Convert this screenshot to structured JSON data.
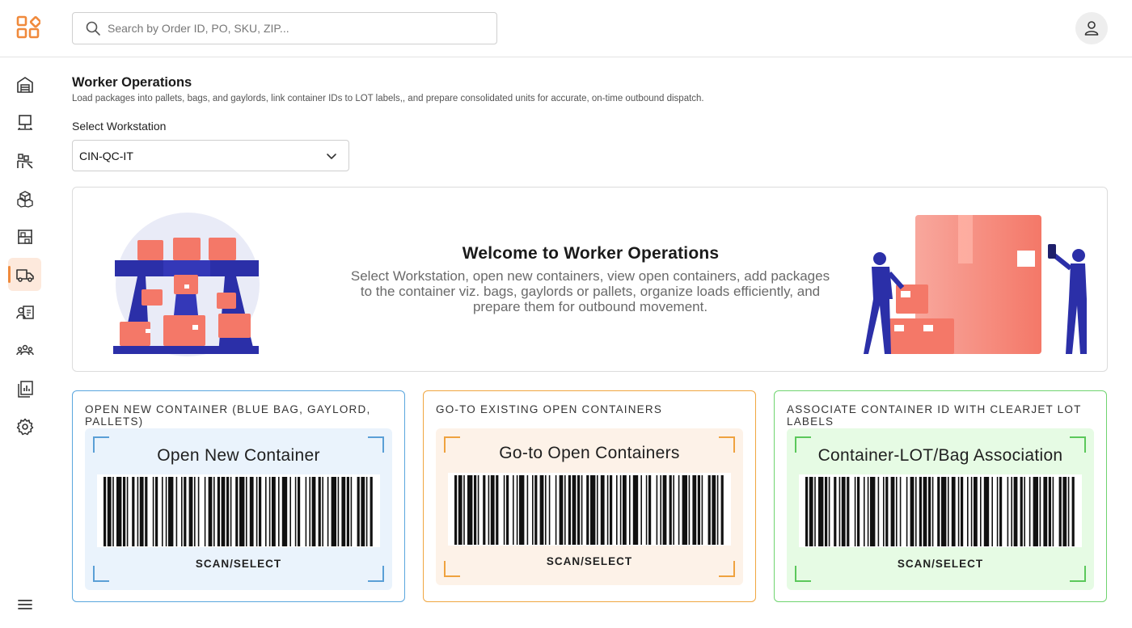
{
  "header": {
    "logo": "app-logo",
    "search": {
      "placeholder": "Search by Order ID, PO, SKU, ZIP...",
      "value": ""
    },
    "user_icon": "user-icon"
  },
  "sidebar": {
    "items": [
      {
        "id": "home",
        "icon": "warehouse-icon",
        "active": false
      },
      {
        "id": "workstation",
        "icon": "workstation-icon",
        "active": false
      },
      {
        "id": "conveyor",
        "icon": "conveyor-icon",
        "active": false
      },
      {
        "id": "inventory",
        "icon": "boxes-icon",
        "active": false
      },
      {
        "id": "storage",
        "icon": "rack-icon",
        "active": false
      },
      {
        "id": "dispatch",
        "icon": "truck-icon",
        "active": true
      },
      {
        "id": "workers",
        "icon": "worker-card-icon",
        "active": false
      },
      {
        "id": "teams",
        "icon": "team-icon",
        "active": false
      },
      {
        "id": "reports",
        "icon": "reports-icon",
        "active": false
      },
      {
        "id": "settings",
        "icon": "gear-icon",
        "active": false
      }
    ],
    "menu_icon": "hamburger-icon"
  },
  "page": {
    "title": "Worker Operations",
    "subtitle": "Load packages into pallets, bags, and gaylords, link container IDs to LOT labels,, and prepare consolidated units for accurate, on-time outbound dispatch.",
    "workstation_label": "Select Workstation",
    "workstation_value": "CIN-QC-IT"
  },
  "welcome": {
    "title": "Welcome to Worker Operations",
    "text": "Select Workstation, open new containers, view open containers, add packages to the container viz. bags, gaylords or pallets, organize loads efficiently, and prepare them for outbound movement."
  },
  "cards": {
    "open_new": {
      "title": "OPEN NEW CONTAINER (BLUE BAG, GAYLORD, PALLETS)",
      "heading": "Open New Container",
      "action": "SCAN/SELECT",
      "accent": "#5aa6de"
    },
    "go_to_existing": {
      "title": "GO-TO EXISTING OPEN CONTAINERS",
      "heading": "Go-to Open Containers",
      "action": "SCAN/SELECT",
      "accent": "#f0a640"
    },
    "associate": {
      "title": "ASSOCIATE CONTAINER ID WITH CLEARJET LOT LABELS",
      "heading": "Container-LOT/Bag Association",
      "action": "SCAN/SELECT",
      "accent": "#6fd46f"
    }
  },
  "colors": {
    "brand": "#f08a3c",
    "active_nav_bg": "#fde9dc",
    "illustration_blue": "#2b2fa8",
    "illustration_coral": "#f47868"
  }
}
